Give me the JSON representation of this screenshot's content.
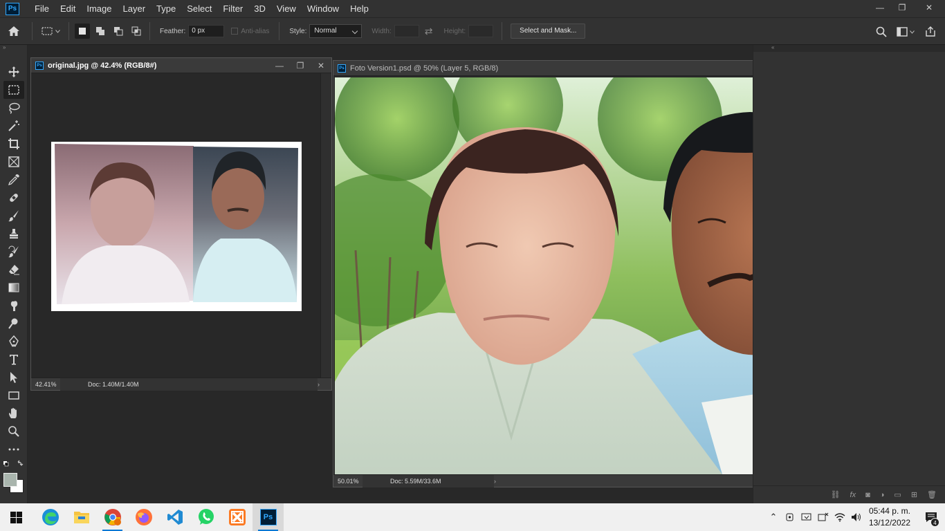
{
  "app": {
    "logo_text": "Ps"
  },
  "menu": [
    "File",
    "Edit",
    "Image",
    "Layer",
    "Type",
    "Select",
    "Filter",
    "3D",
    "View",
    "Window",
    "Help"
  ],
  "window_controls": {
    "minimize": "—",
    "restore": "❐",
    "close": "✕"
  },
  "options": {
    "feather_label": "Feather:",
    "feather_value": "0 px",
    "antialias_label": "Anti-alias",
    "style_label": "Style:",
    "style_value": "Normal",
    "width_label": "Width:",
    "height_label": "Height:",
    "select_mask_label": "Select and Mask..."
  },
  "windows": {
    "original": {
      "title": "original.jpg @ 42.4% (RGB/8#)",
      "zoom": "42.41%",
      "doc": "Doc: 1.40M/1.40M"
    },
    "foto": {
      "title": "Foto Version1.psd @ 50% (Layer 5, RGB/8)",
      "zoom": "50.01%",
      "doc": "Doc: 5.59M/33.6M"
    }
  },
  "taskbar": {
    "time": "05:44 p. m.",
    "date": "13/12/2022",
    "notifications": "4",
    "ps_label": "Ps"
  },
  "colors": {
    "accent": "#31a8ff",
    "foreground_swatch": "#a9b5ad",
    "background_swatch": "#ffffff"
  }
}
